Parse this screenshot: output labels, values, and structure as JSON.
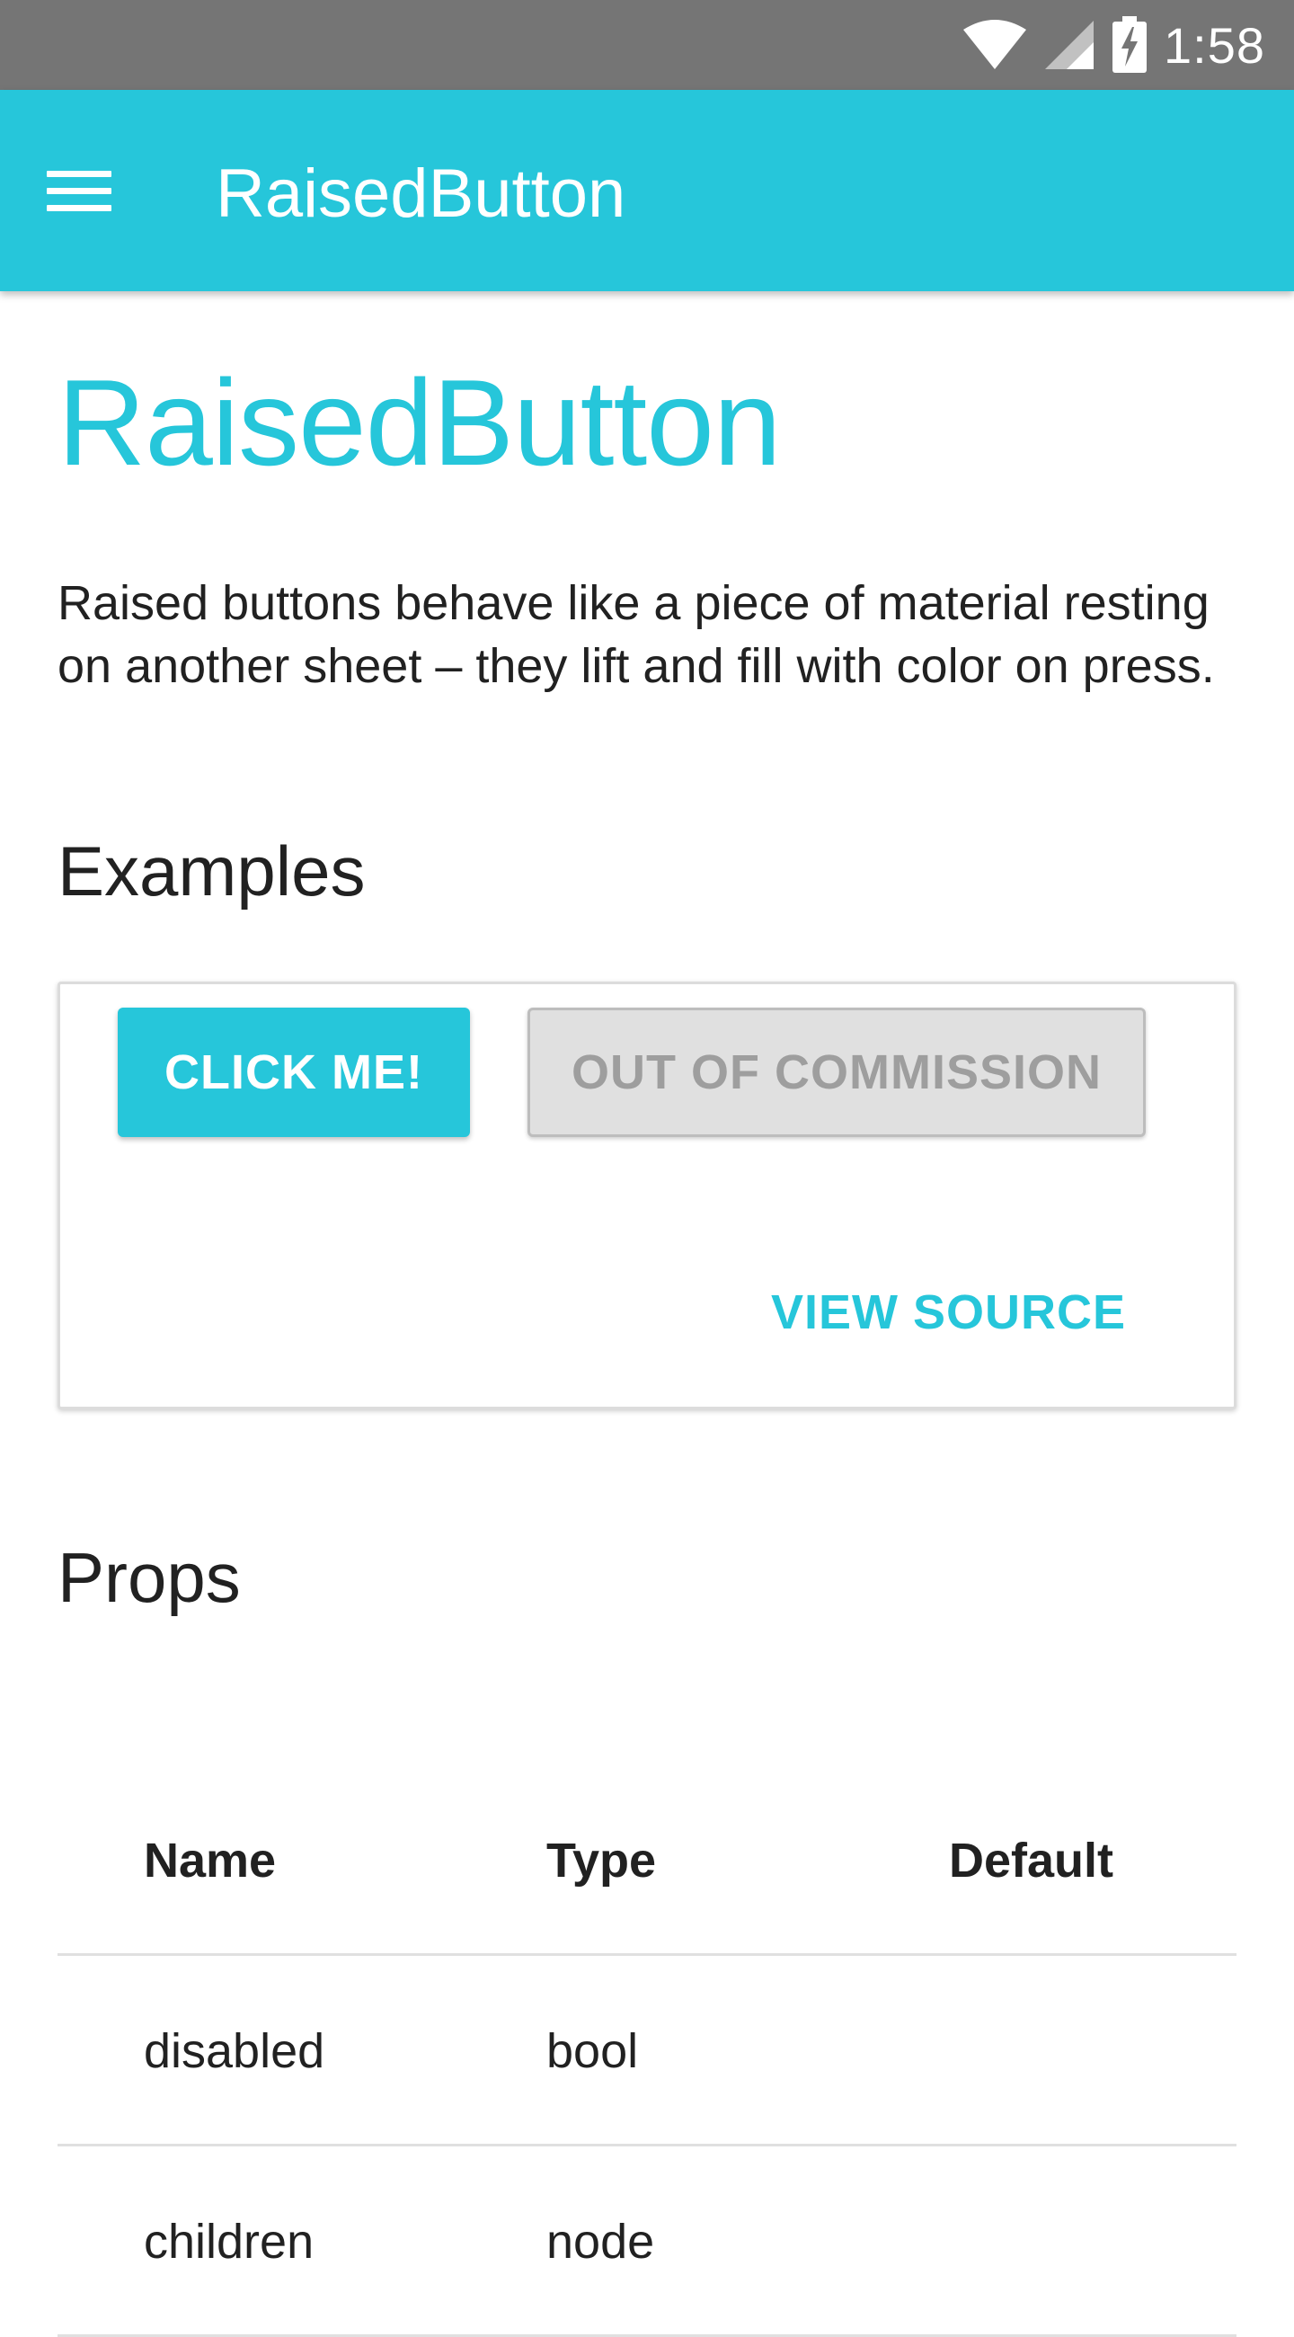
{
  "status_bar": {
    "time": "1:58",
    "icons": [
      "wifi-icon",
      "cell-signal-icon",
      "battery-charging-icon"
    ]
  },
  "app_bar": {
    "title": "RaisedButton",
    "menu_icon": "hamburger-menu-icon",
    "background": "#26c6da"
  },
  "page": {
    "title": "RaisedButton",
    "description": "Raised buttons behave like a piece of material resting on another sheet – they lift and fill with color on press.",
    "accent_color": "#26c6da"
  },
  "examples": {
    "heading": "Examples",
    "primary_button_label": "CLICK ME!",
    "disabled_button_label": "OUT OF COMMISSION",
    "view_source_label": "VIEW SOURCE"
  },
  "props": {
    "heading": "Props",
    "columns": [
      "Name",
      "Type",
      "Default"
    ],
    "rows": [
      {
        "name": "disabled",
        "type": "bool",
        "default": ""
      },
      {
        "name": "children",
        "type": "node",
        "default": ""
      }
    ]
  }
}
